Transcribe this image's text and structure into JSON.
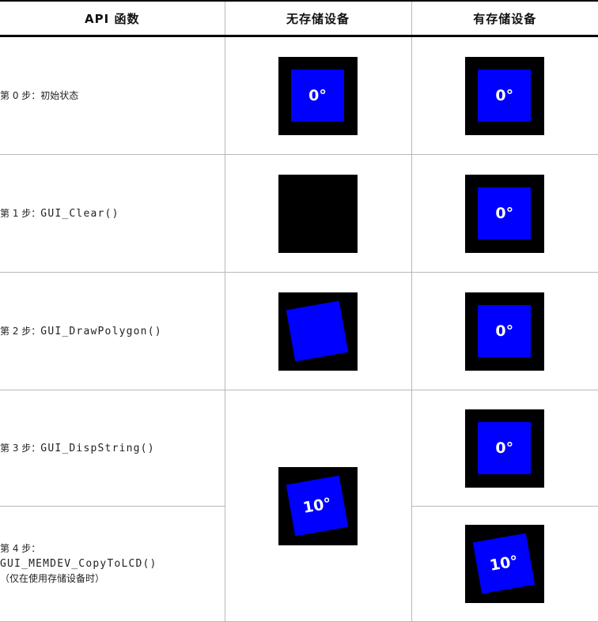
{
  "header": {
    "col_api": "API 函数",
    "col_no_memdev": "无存储设备",
    "col_with_memdev": "有存储设备"
  },
  "rows": [
    {
      "step_prefix": "第 ",
      "step_num": "0",
      "step_suffix": " 步：",
      "step_text": "初始状态",
      "no_memdev_label": "0°",
      "with_memdev_label": "0°"
    },
    {
      "step_prefix": "第 ",
      "step_num": "1",
      "step_suffix": " 步：",
      "step_func": "GUI_Clear()",
      "with_memdev_label": "0°"
    },
    {
      "step_prefix": "第 ",
      "step_num": "2",
      "step_suffix": " 步：",
      "step_func": "GUI_DrawPolygon()",
      "with_memdev_label": "0°"
    },
    {
      "step_prefix": "第 ",
      "step_num": "3",
      "step_suffix": " 步：",
      "step_func": "GUI_DispString()",
      "no_memdev_label": "10°",
      "with_memdev_label": "0°"
    },
    {
      "step_prefix": "第 ",
      "step_num": "4",
      "step_suffix": " 步：",
      "step_func": "GUI_MEMDEV_CopyToLCD()",
      "step_note": "（仅在使用存储设备时）",
      "with_memdev_label": "10°"
    }
  ],
  "colors": {
    "screen_bg": "#000000",
    "square": "#0000ff",
    "text": "#ffffff"
  }
}
